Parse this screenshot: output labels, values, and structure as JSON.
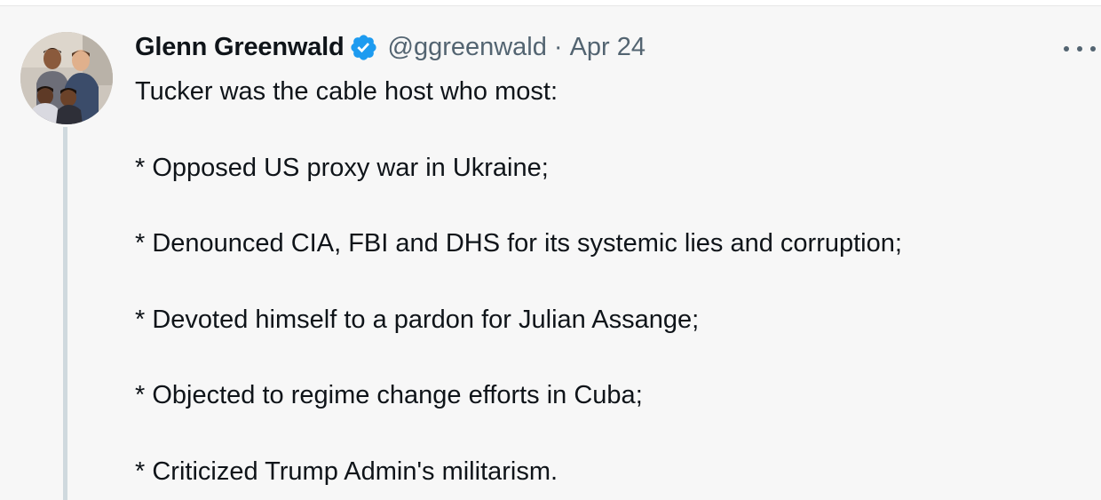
{
  "tweet": {
    "author_name": "Glenn Greenwald",
    "handle": "@ggreenwald",
    "separator": "·",
    "date": "Apr 24",
    "verified_color": "#1d9bf0",
    "intro": "Tucker was the cable host who most:",
    "points": [
      "* Opposed US proxy war in Ukraine;",
      "* Denounced CIA, FBI and DHS for its systemic lies and corruption;",
      "* Devoted himself to a pardon for Julian Assange;",
      "* Objected to regime change efforts in Cuba;",
      "* Criticized Trump Admin's militarism."
    ]
  },
  "icons": {
    "verified": "verified-badge-icon",
    "more": "more-options-icon",
    "avatar": "profile-photo"
  }
}
